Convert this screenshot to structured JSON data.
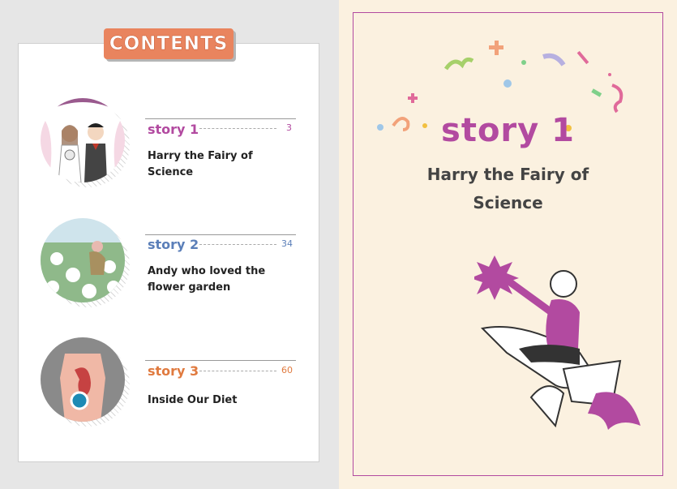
{
  "contents_label": "CONTENTS",
  "stories": [
    {
      "title": "story 1",
      "page": "3",
      "description": "Harry the Fairy of Science",
      "color": "#b24aa0"
    },
    {
      "title": "story 2",
      "page": "34",
      "description": "Andy who loved the flower garden",
      "color": "#5b7fb9"
    },
    {
      "title": "story 3",
      "page": "60",
      "description": "Inside Our Diet",
      "color": "#e07a3f"
    }
  ],
  "feature": {
    "title": "story 1",
    "subtitle": "Harry the Fairy of Science"
  },
  "colors": {
    "accent": "#b24aa0",
    "badge": "#e9845e",
    "page_bg": "#fbf1e0"
  }
}
